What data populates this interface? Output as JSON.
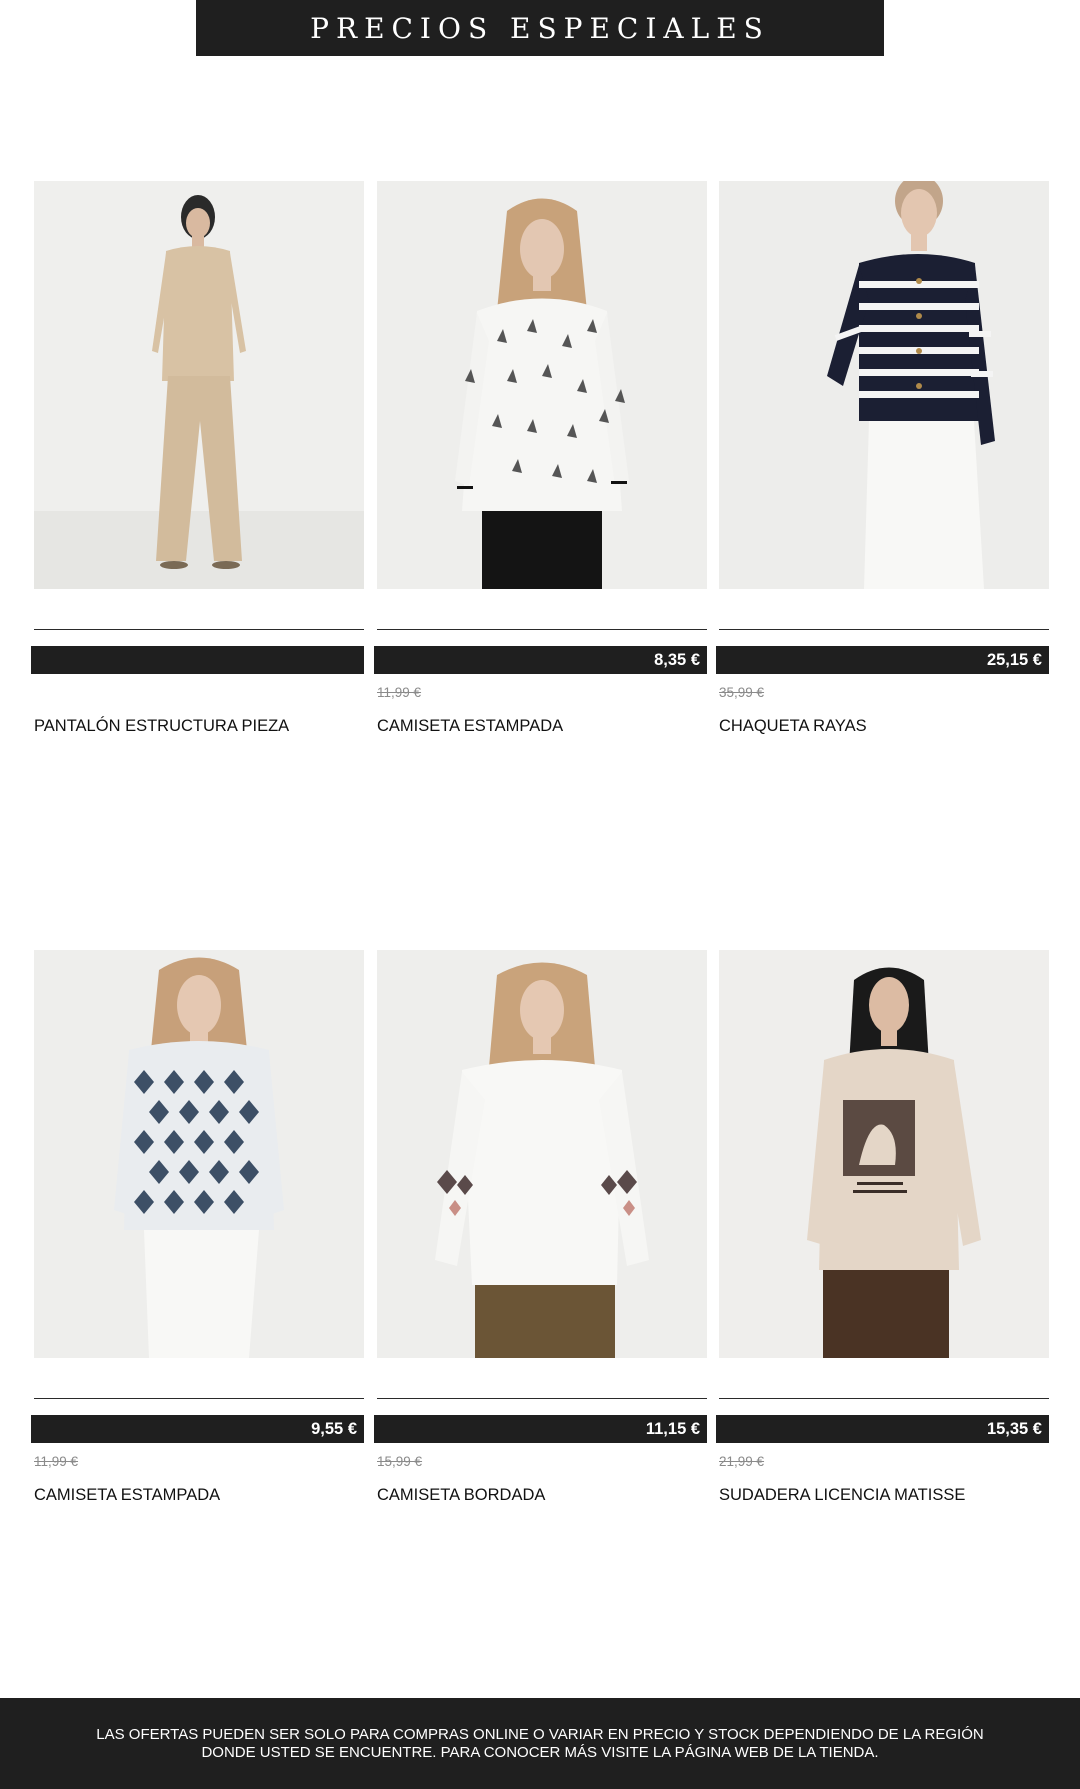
{
  "banner": {
    "title": "PRECIOS ESPECIALES"
  },
  "products": [
    {
      "price": "",
      "old_price": "",
      "name": "PANTALÓN ESTRUCTURA PIEZA"
    },
    {
      "price": "8,35 €",
      "old_price": "11,99 €",
      "name": "CAMISETA ESTAMPADA"
    },
    {
      "price": "25,15 €",
      "old_price": "35,99 €",
      "name": "CHAQUETA RAYAS"
    },
    {
      "price": "9,55 €",
      "old_price": "11,99 €",
      "name": "CAMISETA ESTAMPADA"
    },
    {
      "price": "11,15 €",
      "old_price": "15,99 €",
      "name": "CAMISETA BORDADA"
    },
    {
      "price": "15,35 €",
      "old_price": "21,99 €",
      "name": "SUDADERA LICENCIA MATISSE"
    }
  ],
  "footer": {
    "line1": "LAS OFERTAS PUEDEN SER SOLO PARA COMPRAS ONLINE O VARIAR EN PRECIO Y STOCK DEPENDIENDO DE LA REGIÓN",
    "line2": "DONDE USTED SE ENCUENTRE. PARA CONOCER MÁS VISITE LA PÁGINA WEB DE LA TIENDA."
  },
  "colors": {
    "dark": "#1f1f1f",
    "old_price": "#8a8a8a",
    "photo_bg": "#eeeeec"
  }
}
